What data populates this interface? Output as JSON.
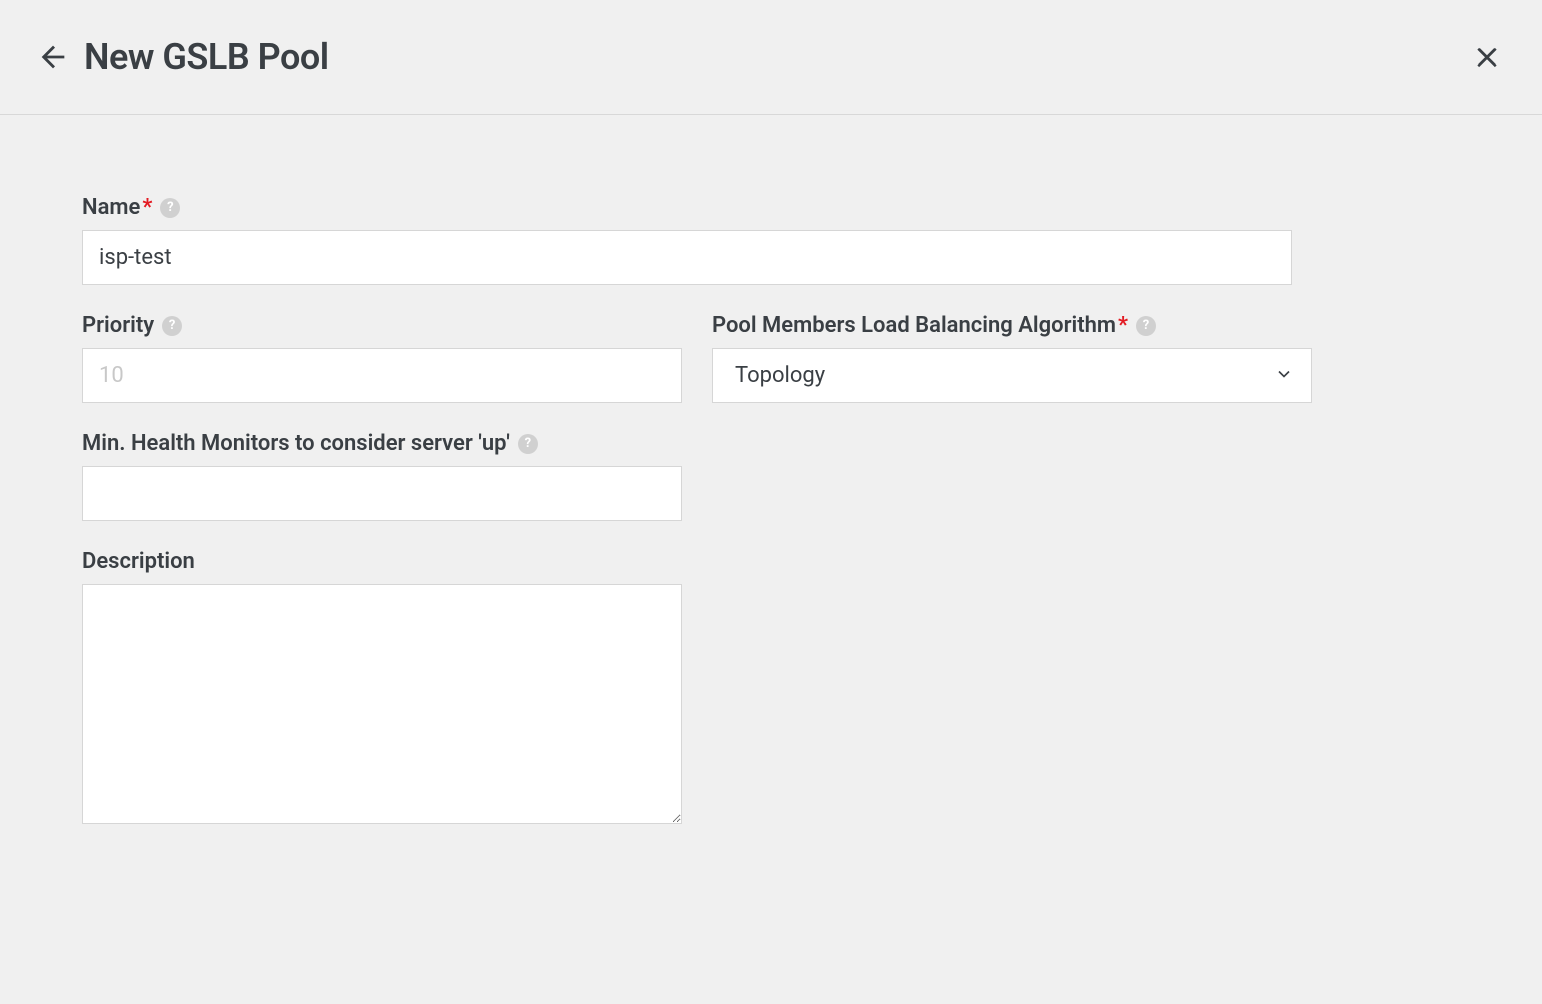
{
  "header": {
    "title": "New GSLB Pool"
  },
  "form": {
    "name": {
      "label": "Name",
      "required": true,
      "value": "isp-test"
    },
    "priority": {
      "label": "Priority",
      "required": false,
      "placeholder": "10",
      "value": ""
    },
    "algorithm": {
      "label": "Pool Members Load Balancing Algorithm",
      "required": true,
      "selected": "Topology"
    },
    "min_monitors": {
      "label": "Min. Health Monitors to consider server 'up'",
      "required": false,
      "value": ""
    },
    "description": {
      "label": "Description",
      "required": false,
      "value": ""
    }
  }
}
